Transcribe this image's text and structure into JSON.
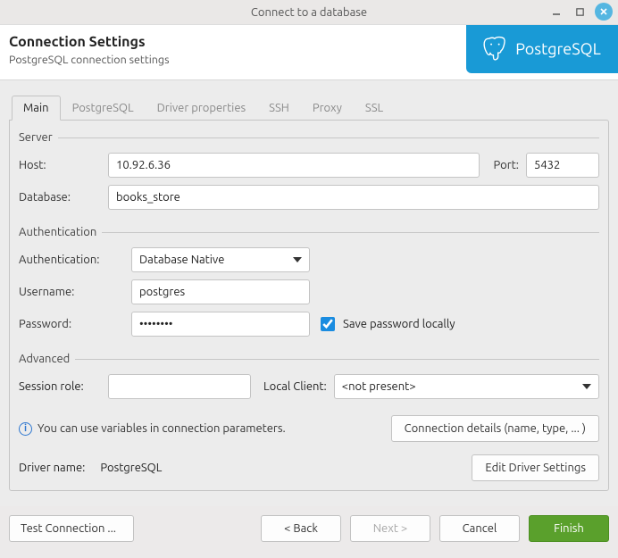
{
  "window": {
    "title": "Connect to a database"
  },
  "header": {
    "title": "Connection Settings",
    "subtitle": "PostgreSQL connection settings",
    "badge": "PostgreSQL"
  },
  "tabs": [
    {
      "label": "Main",
      "active": true
    },
    {
      "label": "PostgreSQL",
      "active": false
    },
    {
      "label": "Driver properties",
      "active": false
    },
    {
      "label": "SSH",
      "active": false
    },
    {
      "label": "Proxy",
      "active": false
    },
    {
      "label": "SSL",
      "active": false
    }
  ],
  "server": {
    "legend": "Server",
    "host_label": "Host:",
    "host": "10.92.6.36",
    "port_label": "Port:",
    "port": "5432",
    "database_label": "Database:",
    "database": "books_store"
  },
  "auth": {
    "legend": "Authentication",
    "auth_label": "Authentication:",
    "auth_mode": "Database Native",
    "username_label": "Username:",
    "username": "postgres",
    "password_label": "Password:",
    "password": "••••••••",
    "save_pw_label": "Save password locally",
    "save_pw_checked": true
  },
  "advanced": {
    "legend": "Advanced",
    "session_role_label": "Session role:",
    "session_role": "",
    "local_client_label": "Local Client:",
    "local_client": "<not present>"
  },
  "info": {
    "text": "You can use variables in connection parameters.",
    "details_btn": "Connection details (name, type, ... )"
  },
  "driver": {
    "label": "Driver name:",
    "value": "PostgreSQL",
    "edit_btn": "Edit Driver Settings"
  },
  "footer": {
    "test": "Test Connection ...",
    "back": "< Back",
    "next": "Next >",
    "cancel": "Cancel",
    "finish": "Finish"
  }
}
